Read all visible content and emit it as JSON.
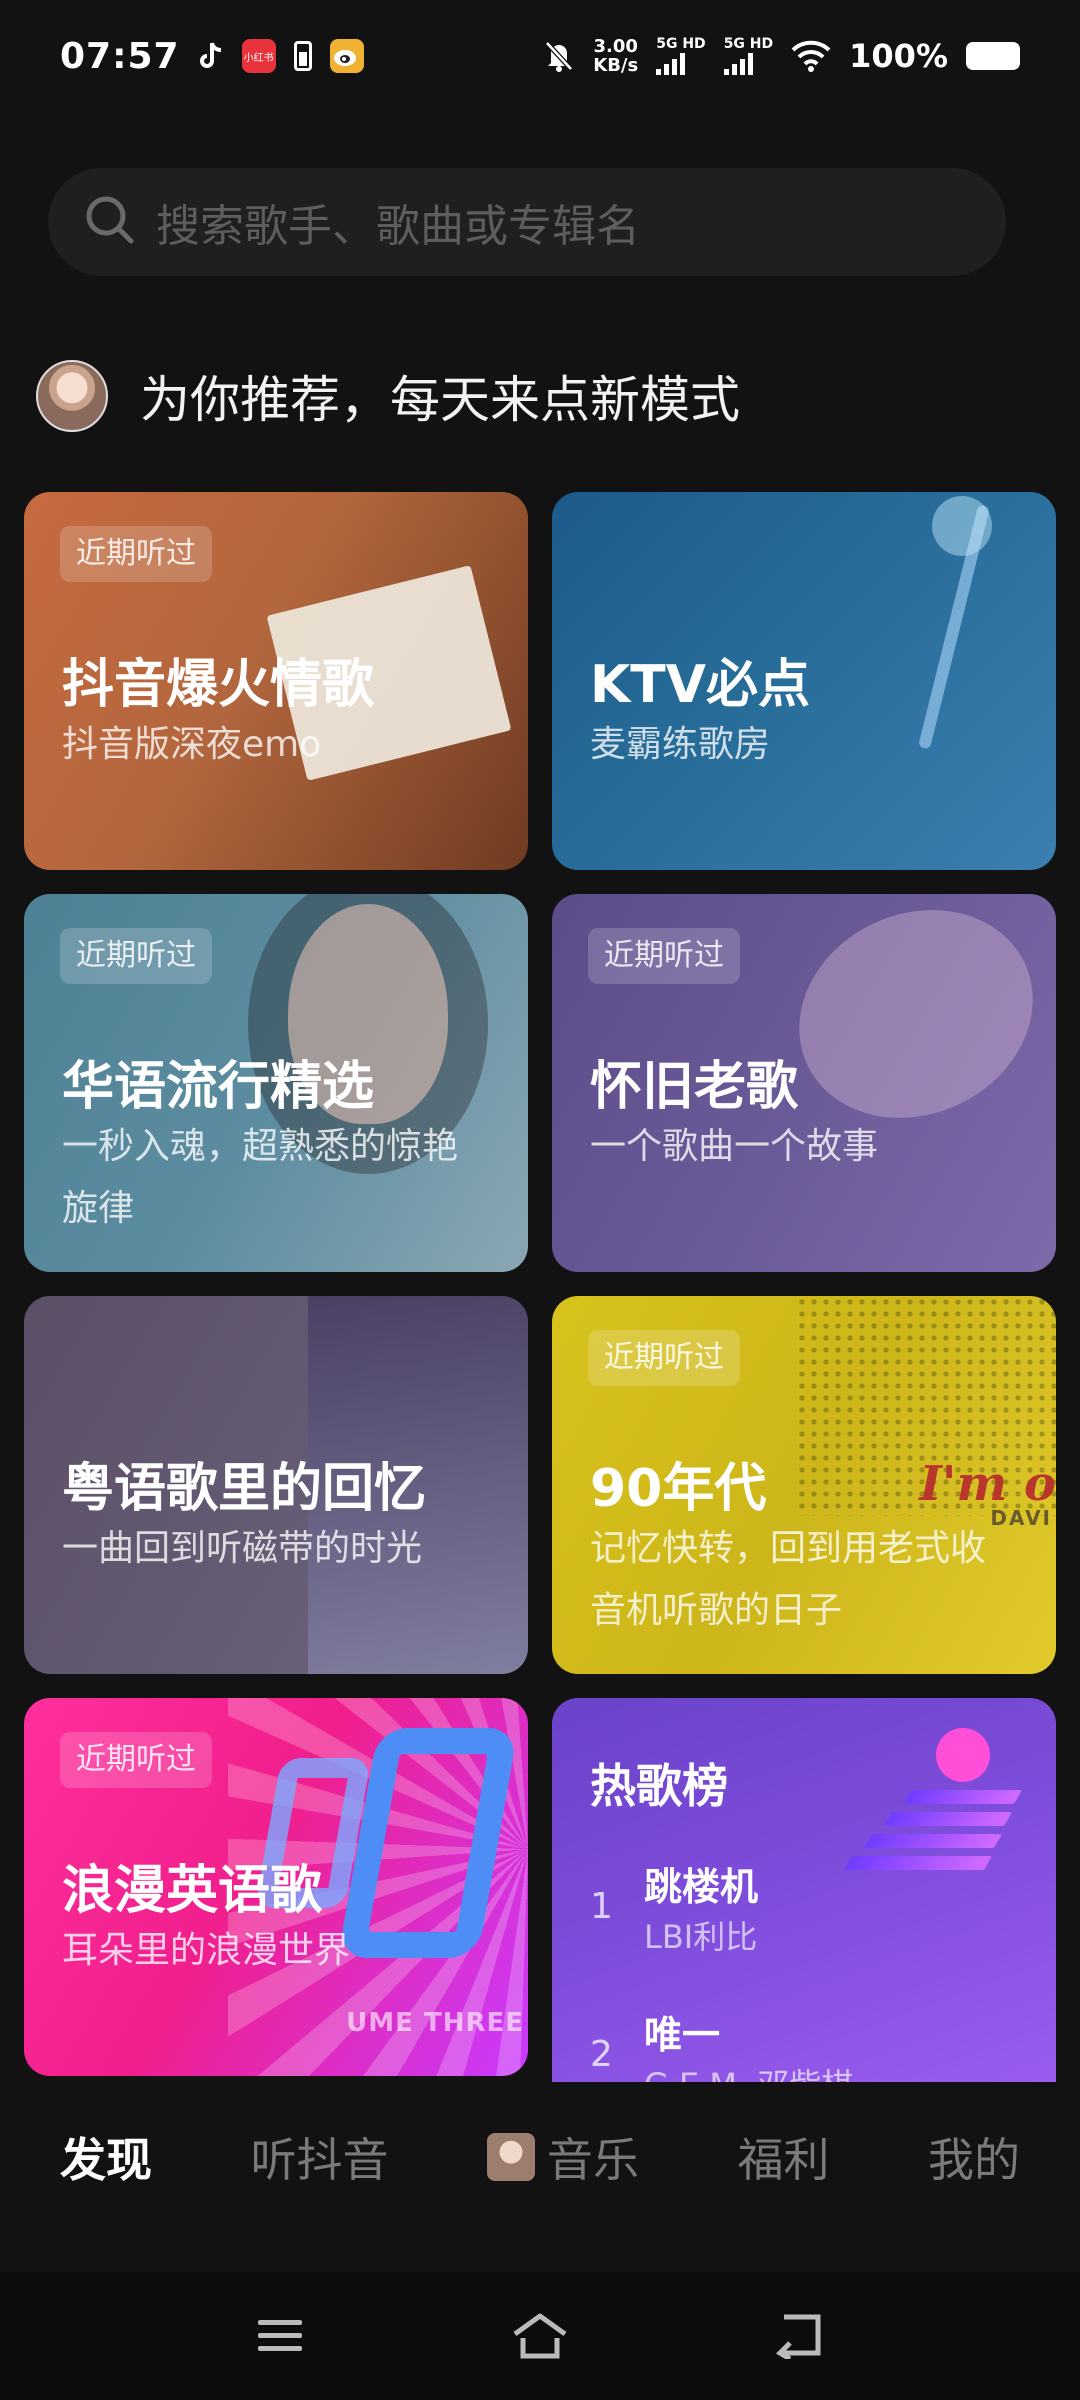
{
  "status_bar": {
    "time": "07:57",
    "mini_app_label": "小红书",
    "net_speed_value": "3.00",
    "net_speed_unit": "KB/s",
    "sim1": "5G HD",
    "sim2": "5G HD",
    "battery": "100%"
  },
  "search": {
    "placeholder": "搜索歌手、歌曲或专辑名"
  },
  "recommend": {
    "title": "为你推荐，每天来点新模式"
  },
  "cards": [
    {
      "tag": "近期听过",
      "title": "抖音爆火情歌",
      "subtitle": "抖音版深夜emo"
    },
    {
      "tag": "",
      "title": "KTV必点",
      "subtitle": "麦霸练歌房"
    },
    {
      "tag": "近期听过",
      "title": "华语流行精选",
      "subtitle": "一秒入魂，超熟悉的惊艳旋律"
    },
    {
      "tag": "近期听过",
      "title": "怀旧老歌",
      "subtitle": "一个歌曲一个故事"
    },
    {
      "tag": "",
      "title": "粤语歌里的回忆",
      "subtitle": "一曲回到听磁带的时光"
    },
    {
      "tag": "近期听过",
      "title": "90年代",
      "subtitle": "记忆快转，回到用老式收音机听歌的日子",
      "art_text": "I'm o",
      "art_text2": "DAVI"
    },
    {
      "tag": "近期听过",
      "title": "浪漫英语歌",
      "subtitle": "耳朵里的浪漫世界",
      "art_text": "UME THREE"
    }
  ],
  "hot_chart": {
    "title": "热歌榜",
    "songs": [
      {
        "rank": "1",
        "name": "跳楼机",
        "singer": "LBI利比"
      },
      {
        "rank": "2",
        "name": "唯一",
        "singer": "G.E.M. 邓紫棋"
      }
    ]
  },
  "bottom_nav": {
    "items": [
      "发现",
      "听抖音",
      "音乐",
      "福利",
      "我的"
    ],
    "active": "发现"
  },
  "colors": {
    "background": "#121212",
    "search_bg": "#1f1f1f",
    "inactive_nav": "#7a7a7a"
  }
}
